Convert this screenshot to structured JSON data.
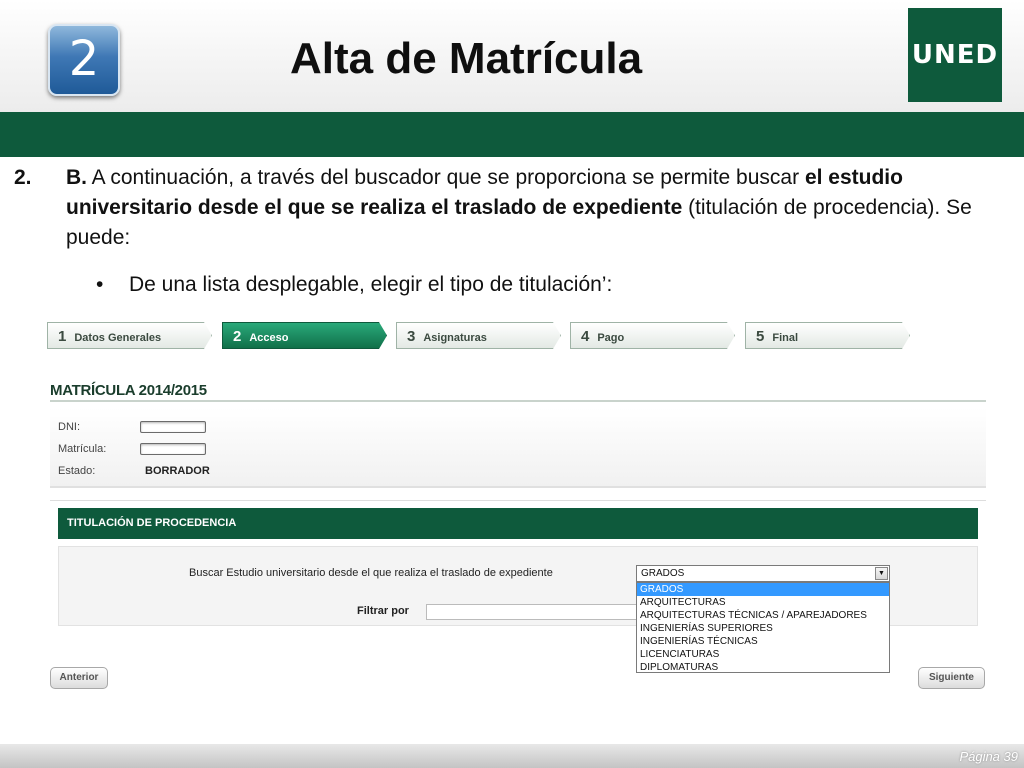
{
  "header": {
    "step_number": "2",
    "title": "Alta de Matrícula",
    "logo_text": "UNED"
  },
  "content": {
    "item_number": "2.",
    "para_lead": "B.",
    "para_part1": " A continuación, a través del buscador que se proporciona se permite buscar ",
    "para_bold": "el estudio universitario desde el que se realiza el traslado de expediente",
    "para_part2": " (titulación de procedencia). Se puede:",
    "bullet_symbol": "•",
    "bullet_text": "De una lista desplegable, elegir el tipo de titulación’:"
  },
  "wizard": {
    "steps": [
      {
        "num": "1",
        "label": "Datos Generales"
      },
      {
        "num": "2",
        "label": "Acceso"
      },
      {
        "num": "3",
        "label": "Asignaturas"
      },
      {
        "num": "4",
        "label": "Pago"
      },
      {
        "num": "5",
        "label": "Final"
      }
    ]
  },
  "form": {
    "title": "MATRÍCULA 2014/2015",
    "dni_label": "DNI:",
    "matricula_label": "Matrícula:",
    "estado_label": "Estado:",
    "estado_value": "BORRADOR",
    "panel_title": "TITULACIÓN DE PROCEDENCIA",
    "search_label": "Buscar Estudio universitario desde el que realiza el traslado de expediente",
    "filter_label": "Filtrar por",
    "select_value": "GRADOS",
    "select_arrow": "▼",
    "options": [
      "GRADOS",
      "ARQUITECTURAS",
      "ARQUITECTURAS TÉCNICAS / APAREJADORES",
      "INGENIERÍAS SUPERIORES",
      "INGENIERÍAS TÉCNICAS",
      "LICENCIATURAS",
      "DIPLOMATURAS"
    ],
    "prev_button": "Anterior",
    "next_button": "Siguiente"
  },
  "footer": {
    "page": "Página 39"
  },
  "colors": {
    "brand_green": "#0e5a3c",
    "active_step": "#117049",
    "selection_blue": "#3399ff"
  }
}
